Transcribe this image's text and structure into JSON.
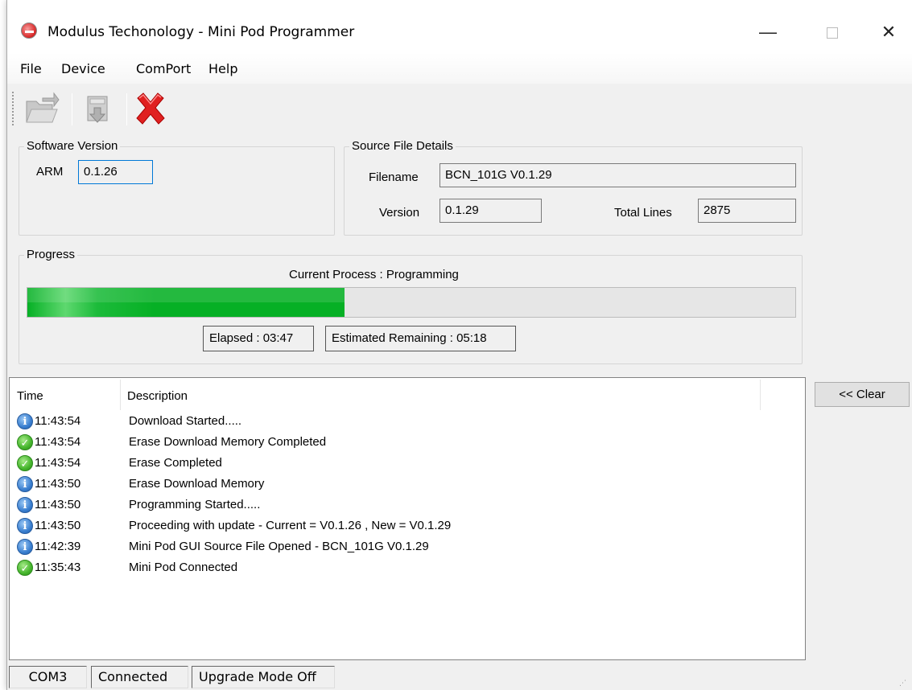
{
  "window": {
    "title": "Modulus Techonology - Mini Pod Programmer",
    "minimize": "—",
    "close": "✕"
  },
  "menu": [
    "File",
    "Device",
    "ComPort",
    "Help"
  ],
  "toolbar": {
    "icons": [
      "open-folder-icon",
      "download-icon",
      "cancel-x-icon"
    ]
  },
  "software_version": {
    "title": "Software Version",
    "arm_label": "ARM",
    "arm_value": "0.1.26"
  },
  "source_file": {
    "title": "Source File Details",
    "filename_label": "Filename",
    "filename_value": "BCN_101G V0.1.29",
    "version_label": "Version",
    "version_value": "0.1.29",
    "total_lines_label": "Total Lines",
    "total_lines_value": "2875"
  },
  "progress": {
    "title": "Progress",
    "current_process": "Current Process :  Programming",
    "fraction": 0.413,
    "elapsed": "Elapsed : 03:47",
    "remaining": "Estimated Remaining : 05:18",
    "fill_color": "#06b025"
  },
  "log": {
    "columns": [
      "Time",
      "Description"
    ],
    "rows": [
      {
        "icon": "info",
        "time": "11:43:54",
        "desc": "Download Started....."
      },
      {
        "icon": "ok",
        "time": "11:43:54",
        "desc": "Erase Download Memory Completed"
      },
      {
        "icon": "ok",
        "time": "11:43:54",
        "desc": "Erase Completed"
      },
      {
        "icon": "info",
        "time": "11:43:50",
        "desc": "Erase Download Memory"
      },
      {
        "icon": "info",
        "time": "11:43:50",
        "desc": "Programming Started....."
      },
      {
        "icon": "info",
        "time": "11:43:50",
        "desc": "Proceeding with update - Current = V0.1.26  , New = V0.1.29"
      },
      {
        "icon": "info",
        "time": "11:42:39",
        "desc": "Mini Pod GUI Source File Opened - BCN_101G V0.1.29"
      },
      {
        "icon": "ok",
        "time": "11:35:43",
        "desc": "Mini Pod Connected"
      }
    ]
  },
  "clear_button": "<< Clear",
  "status": {
    "port": "COM3",
    "connection": "Connected",
    "mode": "Upgrade Mode Off"
  }
}
